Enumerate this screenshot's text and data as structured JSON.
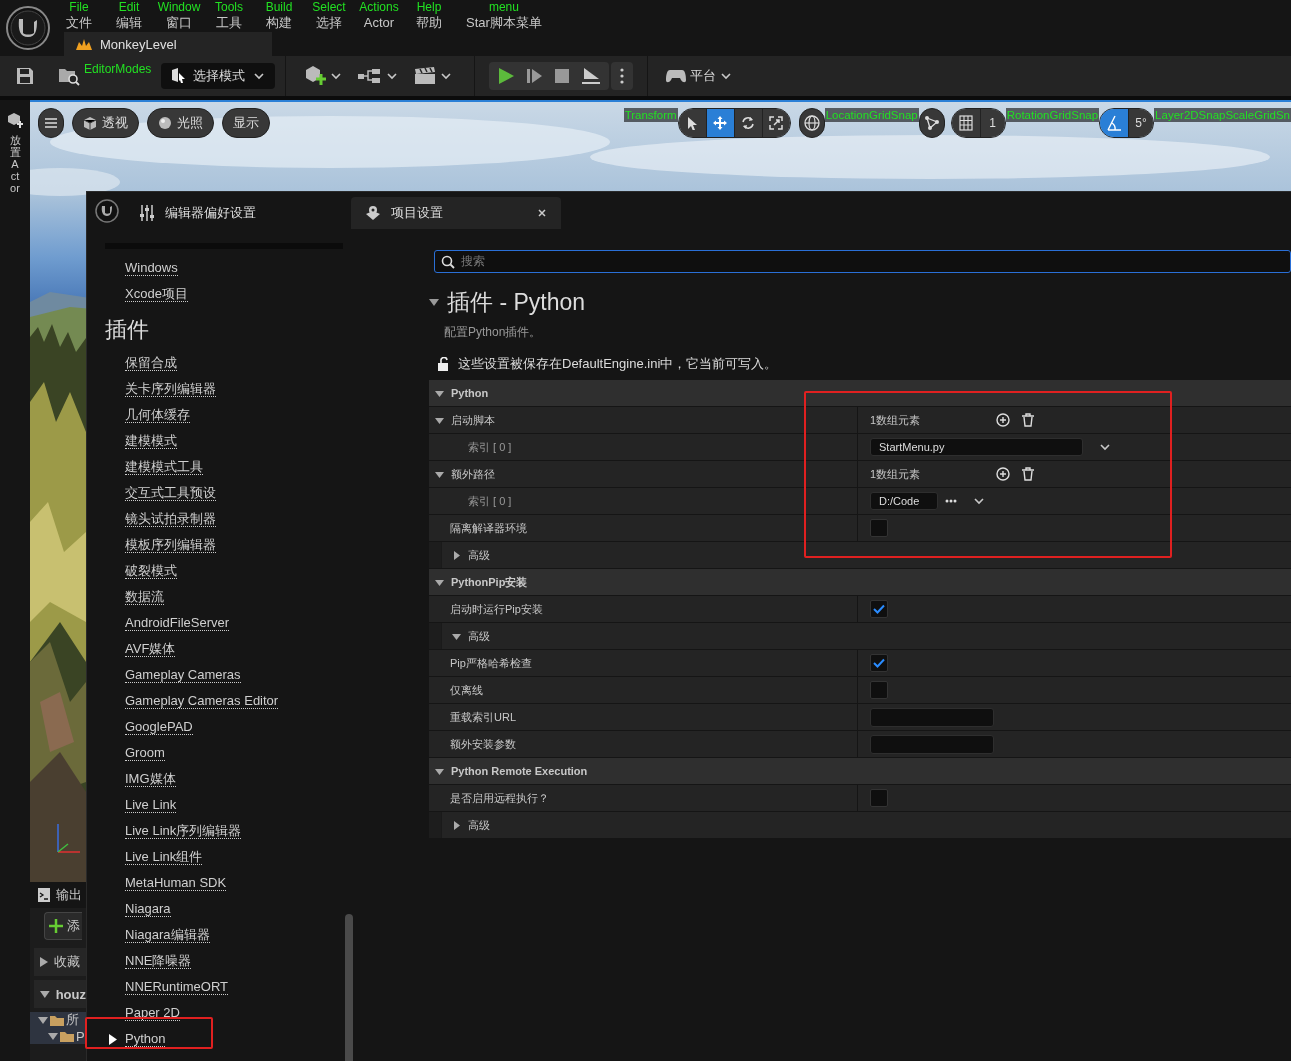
{
  "title_bar": {
    "menu": [
      {
        "overlay_label": "File",
        "label": "文件"
      },
      {
        "overlay_label": "Edit",
        "label": "编辑"
      },
      {
        "overlay_label": "Window",
        "label": "窗口"
      },
      {
        "overlay_label": "Tools",
        "label": "工具"
      },
      {
        "overlay_label": "Build",
        "label": "构建"
      },
      {
        "overlay_label": "Select",
        "label": "选择"
      },
      {
        "overlay_label": "Actions",
        "label": "Actor"
      },
      {
        "overlay_label": "Help",
        "label": "帮助"
      },
      {
        "overlay_label": "menu",
        "label": "Star脚本菜单"
      }
    ],
    "level_tab": "MonkeyLevel"
  },
  "toolbar": {
    "overlay_label": "EditorModes",
    "mode_dropdown": "选择模式",
    "platforms": "平台"
  },
  "side_tab": "放置Actor",
  "viewport": {
    "buttons": [
      "透视",
      "光照",
      "显示"
    ],
    "transform_label": "Transform",
    "transform_tools": [
      {
        "kind": "select",
        "selected": false
      },
      {
        "kind": "move",
        "selected": true
      },
      {
        "kind": "rotate",
        "selected": false
      },
      {
        "kind": "scale",
        "selected": false
      }
    ],
    "location_snap_label": "LocationGridSnap",
    "grid_snap_value": "1",
    "rotation_snap_label": "RotationGridSnap",
    "rotation_snap": {
      "on": true,
      "value": "5°"
    },
    "scale_snap_label": "Layer2DSnapScaleGridSn"
  },
  "bottom_panel": {
    "output_tab": "输出",
    "add_button": "添",
    "favorites": "收藏",
    "project": "houz",
    "folders": [
      "所",
      "P"
    ]
  },
  "settings_window": {
    "tabs": [
      {
        "label": "编辑器偏好设置",
        "selected": false
      },
      {
        "label": "项目设置",
        "selected": true
      }
    ],
    "nav": [
      {
        "kind": "link",
        "label": "Windows",
        "selected": false,
        "highlighted": false
      },
      {
        "kind": "link",
        "label": "Xcode项目",
        "selected": false,
        "highlighted": false
      },
      {
        "kind": "heading",
        "label": "插件"
      },
      {
        "kind": "link",
        "label": "保留合成",
        "selected": false,
        "highlighted": false
      },
      {
        "kind": "link",
        "label": "关卡序列编辑器",
        "selected": false,
        "highlighted": false
      },
      {
        "kind": "link",
        "label": "几何体缓存",
        "selected": false,
        "highlighted": false
      },
      {
        "kind": "link",
        "label": "建模模式",
        "selected": false,
        "highlighted": false
      },
      {
        "kind": "link",
        "label": "建模模式工具",
        "selected": false,
        "highlighted": false
      },
      {
        "kind": "link",
        "label": "交互式工具预设",
        "selected": false,
        "highlighted": false
      },
      {
        "kind": "link",
        "label": "镜头试拍录制器",
        "selected": false,
        "highlighted": false
      },
      {
        "kind": "link",
        "label": "模板序列编辑器",
        "selected": false,
        "highlighted": false
      },
      {
        "kind": "link",
        "label": "破裂模式",
        "selected": false,
        "highlighted": false
      },
      {
        "kind": "link",
        "label": "数据流",
        "selected": false,
        "highlighted": false
      },
      {
        "kind": "link",
        "label": "AndroidFileServer",
        "selected": false,
        "highlighted": false
      },
      {
        "kind": "link",
        "label": "AVF媒体",
        "selected": false,
        "highlighted": false
      },
      {
        "kind": "link",
        "label": "Gameplay Cameras",
        "selected": false,
        "highlighted": false
      },
      {
        "kind": "link",
        "label": "Gameplay Cameras Editor",
        "selected": false,
        "highlighted": false
      },
      {
        "kind": "link",
        "label": "GooglePAD",
        "selected": false,
        "highlighted": false
      },
      {
        "kind": "link",
        "label": "Groom",
        "selected": false,
        "highlighted": false
      },
      {
        "kind": "link",
        "label": "IMG媒体",
        "selected": false,
        "highlighted": false
      },
      {
        "kind": "link",
        "label": "Live Link",
        "selected": false,
        "highlighted": false
      },
      {
        "kind": "link",
        "label": "Live Link序列编辑器",
        "selected": false,
        "highlighted": false
      },
      {
        "kind": "link",
        "label": "Live Link组件",
        "selected": false,
        "highlighted": false
      },
      {
        "kind": "link",
        "label": "MetaHuman SDK",
        "selected": false,
        "highlighted": false
      },
      {
        "kind": "link",
        "label": "Niagara",
        "selected": false,
        "highlighted": false
      },
      {
        "kind": "link",
        "label": "Niagara编辑器",
        "selected": false,
        "highlighted": false
      },
      {
        "kind": "link",
        "label": "NNE降噪器",
        "selected": false,
        "highlighted": false
      },
      {
        "kind": "link",
        "label": "NNERuntimeORT",
        "selected": false,
        "highlighted": false
      },
      {
        "kind": "link",
        "label": "Paper 2D",
        "selected": false,
        "highlighted": false
      },
      {
        "kind": "link",
        "label": "Python",
        "selected": true,
        "highlighted": true
      }
    ],
    "search": {
      "placeholder": "搜索"
    },
    "title": "插件 - Python",
    "description": "配置Python插件。",
    "storage_note": "这些设置被保存在DefaultEngine.ini中，它当前可写入。",
    "sections": [
      {
        "title": "Python",
        "expanded": true,
        "highlighted": true,
        "rows": [
          {
            "kind": "array",
            "label": "启动脚本",
            "expanded": true,
            "count": "1数组元素",
            "children": [
              {
                "kind": "combo",
                "label": "索引 [ 0 ]",
                "value": "StartMenu.py"
              }
            ]
          },
          {
            "kind": "array",
            "label": "额外路径",
            "expanded": true,
            "count": "1数组元素",
            "children": [
              {
                "kind": "path",
                "label": "索引 [ 0 ]",
                "value": "D:/Code"
              }
            ]
          },
          {
            "kind": "checkbox",
            "label": "隔离解译器环境",
            "checked": false
          },
          {
            "kind": "group",
            "label": "高级",
            "expanded": false
          }
        ]
      },
      {
        "title": "PythonPip安装",
        "expanded": true,
        "highlighted": false,
        "rows": [
          {
            "kind": "checkbox",
            "label": "启动时运行Pip安装",
            "checked": true
          },
          {
            "kind": "group",
            "label": "高级",
            "expanded": true,
            "children": [
              {
                "kind": "checkbox",
                "label": "Pip严格哈希检查",
                "checked": true
              },
              {
                "kind": "checkbox",
                "label": "仅离线",
                "checked": false
              },
              {
                "kind": "text",
                "label": "重载索引URL"
              },
              {
                "kind": "text",
                "label": "额外安装参数"
              }
            ]
          }
        ]
      },
      {
        "title": "Python Remote Execution",
        "expanded": true,
        "highlighted": false,
        "rows": [
          {
            "kind": "checkbox",
            "label": "是否启用远程执行？",
            "checked": false
          },
          {
            "kind": "group",
            "label": "高级",
            "expanded": false
          }
        ]
      }
    ]
  }
}
